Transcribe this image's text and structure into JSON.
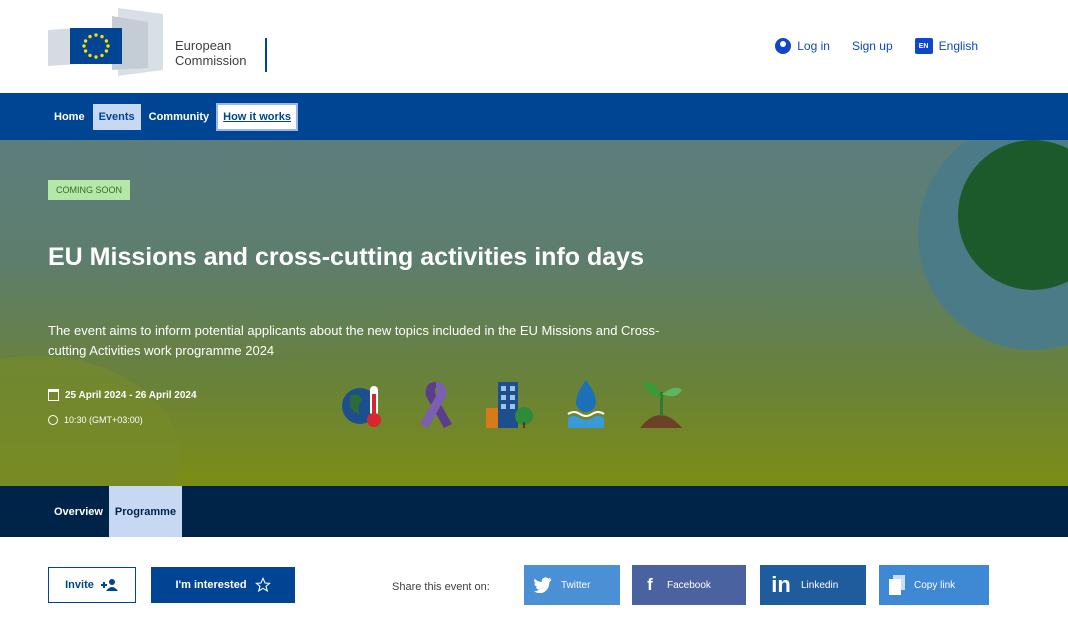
{
  "header": {
    "logo_line1": "European",
    "logo_line2": "Commission",
    "login": "Log in",
    "signup": "Sign up",
    "language_code": "EN",
    "language": "English"
  },
  "nav": {
    "items": [
      {
        "label": "Home"
      },
      {
        "label": "Events"
      },
      {
        "label": "Community"
      },
      {
        "label": "How it works"
      }
    ]
  },
  "hero": {
    "badge": "COMING SOON",
    "title": "EU Missions and cross-cutting activities info days",
    "description": "The event aims to inform potential applicants about the new topics included in the EU Missions and Cross-cutting Activities work programme 2024",
    "date": "25 April 2024 - 26 April 2024",
    "time": "10:30 (GMT+03:00)",
    "icons": [
      "climate-adaptation-icon",
      "cancer-ribbon-icon",
      "smart-city-icon",
      "ocean-water-icon",
      "soil-health-icon"
    ]
  },
  "subnav": {
    "items": [
      {
        "label": "Overview"
      },
      {
        "label": "Programme"
      }
    ]
  },
  "actions": {
    "invite": "Invite",
    "interested": "I'm interested",
    "share_label": "Share this event on:",
    "share": [
      {
        "label": "Twitter"
      },
      {
        "label": "Facebook"
      },
      {
        "label": "Linkedin"
      },
      {
        "label": "Copy link"
      }
    ]
  },
  "colors": {
    "primary": "#004494",
    "dark_nav": "#002447",
    "badge_bg": "#b5e7a9",
    "link": "#0e47cb"
  }
}
